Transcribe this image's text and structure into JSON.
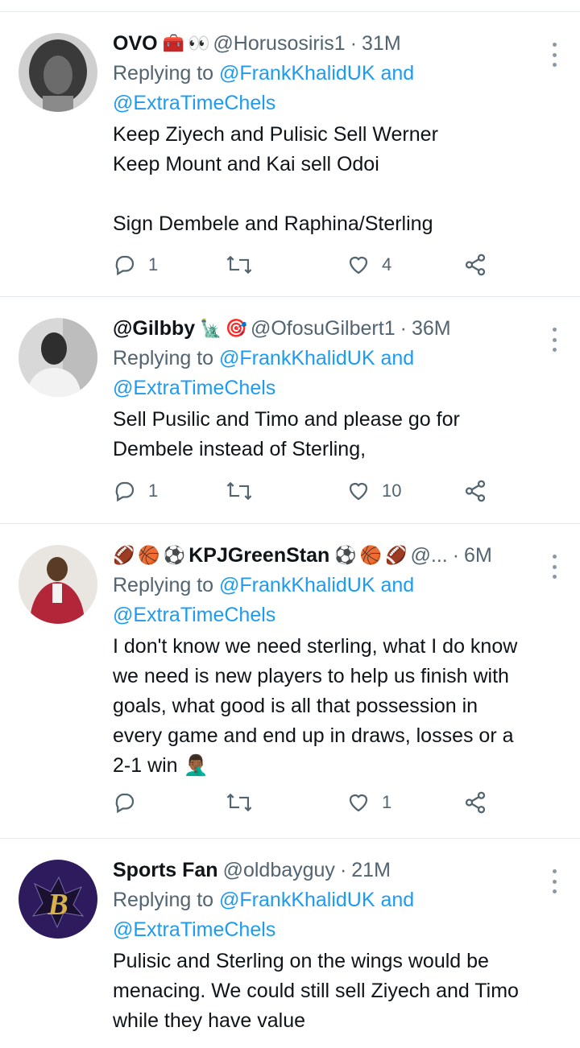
{
  "tweets": [
    {
      "name": "OVO",
      "name_emojis": [
        "🧰",
        "👀"
      ],
      "handle": "@Horusosiris1",
      "time": "31M",
      "replying_prefix": "Replying to",
      "replying_mentions": "@FrankKhalidUK and",
      "replying_mentions2": "@ExtraTimeChels",
      "text": "Keep Ziyech and Pulisic Sell Werner\nKeep Mount and Kai sell Odoi\n\nSign Dembele and Raphina/Sterling",
      "replies": "1",
      "retweets": "",
      "likes": "4"
    },
    {
      "name": "@Gilbby",
      "name_emojis": [
        "🗽",
        "🎯"
      ],
      "handle": "@OfosuGilbert1",
      "time": "36M",
      "replying_prefix": "Replying to",
      "replying_mentions": "@FrankKhalidUK and",
      "replying_mentions2": "@ExtraTimeChels",
      "text": "Sell Pusilic and Timo and please go for\nDembele instead of Sterling,",
      "replies": "1",
      "retweets": "",
      "likes": "10"
    },
    {
      "name": "KPJGreenStan",
      "prefix_emojis": [
        "🏈",
        "🏀",
        "⚽"
      ],
      "name_emojis": [
        "⚽",
        "🏀",
        "🏈"
      ],
      "handle": "@...",
      "time": "6M",
      "replying_prefix": "Replying to",
      "replying_mentions": "@FrankKhalidUK and",
      "replying_mentions2": "@ExtraTimeChels",
      "text": "I don't know we need sterling, what I do know\nwe need is new players to help us finish with\ngoals, what good is all that possession in\nevery game and end up in draws, losses or a\n2-1 win 🤦🏾‍♂️",
      "replies": "",
      "retweets": "",
      "likes": "1"
    },
    {
      "name": "Sports Fan",
      "handle": "@oldbayguy",
      "time": "21M",
      "replying_prefix": "Replying to",
      "replying_mentions": "@FrankKhalidUK and",
      "replying_mentions2": "@ExtraTimeChels",
      "text": "Pulisic and Sterling on the wings would be\nmenacing. We could still sell Ziyech and Timo\nwhile they have value"
    }
  ],
  "colors": {
    "text": "#0f1419",
    "secondary": "#536471",
    "link": "#1d9bf0",
    "border": "#e6e9eb"
  },
  "icons": {
    "reply": "reply-icon",
    "retweet": "retweet-icon",
    "like": "heart-icon",
    "share": "share-icon",
    "more": "more-icon"
  }
}
